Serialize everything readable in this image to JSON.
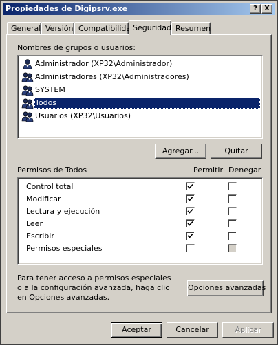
{
  "window": {
    "title": "Propiedades de Digipsrv.exe",
    "help_button": "?",
    "close_button": "X"
  },
  "tabs": [
    {
      "label": "General",
      "active": false
    },
    {
      "label": "Versión",
      "active": false
    },
    {
      "label": "Compatibilidad",
      "active": false
    },
    {
      "label": "Seguridad",
      "active": true
    },
    {
      "label": "Resumen",
      "active": false
    }
  ],
  "groups": {
    "label": "Nombres de grupos o usuarios:",
    "items": [
      {
        "name": "Administrador (XP32\\Administrador)",
        "selected": false,
        "icon": "user-icon"
      },
      {
        "name": "Administradores (XP32\\Administradores)",
        "selected": false,
        "icon": "users-group-icon"
      },
      {
        "name": "SYSTEM",
        "selected": false,
        "icon": "users-group-icon"
      },
      {
        "name": "Todos",
        "selected": true,
        "icon": "users-group-icon"
      },
      {
        "name": "Usuarios (XP32\\Usuarios)",
        "selected": false,
        "icon": "users-group-icon"
      }
    ],
    "add_button": "Agregar...",
    "remove_button": "Quitar"
  },
  "permissions": {
    "label": "Permisos de Todos",
    "allow_header": "Permitir",
    "deny_header": "Denegar",
    "rows": [
      {
        "name": "Control total",
        "allow": true,
        "deny": false,
        "deny_disabled": false
      },
      {
        "name": "Modificar",
        "allow": true,
        "deny": false,
        "deny_disabled": false
      },
      {
        "name": "Lectura y ejecución",
        "allow": true,
        "deny": false,
        "deny_disabled": false
      },
      {
        "name": "Leer",
        "allow": true,
        "deny": false,
        "deny_disabled": false
      },
      {
        "name": "Escribir",
        "allow": true,
        "deny": false,
        "deny_disabled": false
      },
      {
        "name": "Permisos especiales",
        "allow": false,
        "deny": false,
        "deny_disabled": true
      }
    ]
  },
  "advanced": {
    "text_line1": "Para tener acceso a permisos especiales",
    "text_line2": "o a la configuración avanzada, haga clic",
    "text_line3": "en Opciones avanzadas.",
    "button": "Opciones avanzadas"
  },
  "footer": {
    "ok": "Aceptar",
    "cancel": "Cancelar",
    "apply": "Aplicar"
  },
  "colors": {
    "title_gradient_start": "#0a246a",
    "title_gradient_end": "#a6caf0",
    "selection": "#0a246a",
    "face": "#d4d0c8"
  }
}
